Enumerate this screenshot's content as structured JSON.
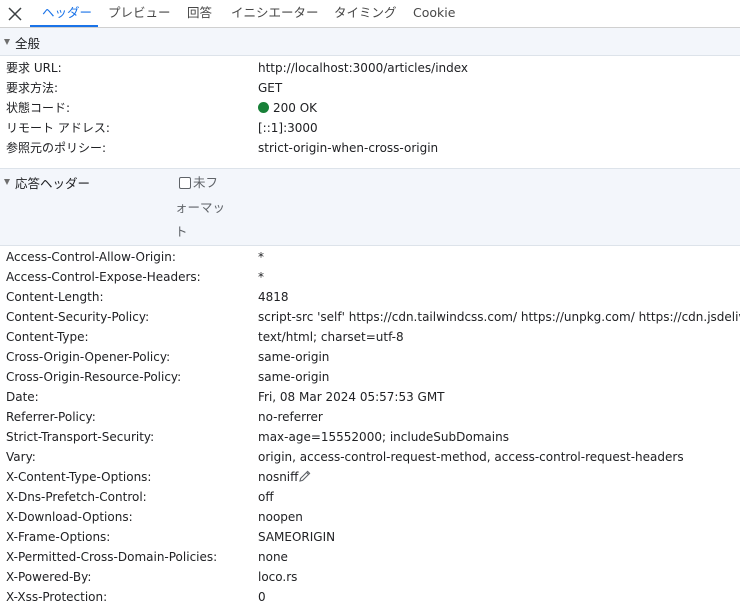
{
  "tabs": [
    {
      "label": "ヘッダー",
      "active": true
    },
    {
      "label": "プレビュー"
    },
    {
      "label": "回答"
    },
    {
      "label": "イニシエーター"
    },
    {
      "label": "タイミング"
    },
    {
      "label": "Cookie"
    }
  ],
  "general": {
    "title": "全般",
    "rows": [
      {
        "key": "要求 URL:",
        "value": "http://localhost:3000/articles/index"
      },
      {
        "key": "要求方法:",
        "value": "GET"
      },
      {
        "key": "状態コード:",
        "value": "200 OK"
      },
      {
        "key": "リモート アドレス:",
        "value": "[::1]:3000"
      },
      {
        "key": "参照元のポリシー:",
        "value": "strict-origin-when-cross-origin"
      }
    ]
  },
  "response": {
    "title": "応答ヘッダー",
    "raw_label": "未フォーマット",
    "rows": [
      {
        "key": "Access-Control-Allow-Origin:",
        "value": "*"
      },
      {
        "key": "Access-Control-Expose-Headers:",
        "value": "*"
      },
      {
        "key": "Content-Length:",
        "value": "4818"
      },
      {
        "key": "Content-Security-Policy:",
        "value": "script-src 'self' https://cdn.tailwindcss.com/ https://unpkg.com/ https://cdn.jsdelivr.net/"
      },
      {
        "key": "Content-Type:",
        "value": "text/html; charset=utf-8"
      },
      {
        "key": "Cross-Origin-Opener-Policy:",
        "value": "same-origin"
      },
      {
        "key": "Cross-Origin-Resource-Policy:",
        "value": "same-origin"
      },
      {
        "key": "Date:",
        "value": "Fri, 08 Mar 2024 05:57:53 GMT"
      },
      {
        "key": "Referrer-Policy:",
        "value": "no-referrer"
      },
      {
        "key": "Strict-Transport-Security:",
        "value": "max-age=15552000; includeSubDomains"
      },
      {
        "key": "Vary:",
        "value": "origin, access-control-request-method, access-control-request-headers"
      },
      {
        "key": "X-Content-Type-Options:",
        "value": "nosniff"
      },
      {
        "key": "X-Dns-Prefetch-Control:",
        "value": "off"
      },
      {
        "key": "X-Download-Options:",
        "value": "noopen"
      },
      {
        "key": "X-Frame-Options:",
        "value": "SAMEORIGIN"
      },
      {
        "key": "X-Permitted-Cross-Domain-Policies:",
        "value": "none"
      },
      {
        "key": "X-Powered-By:",
        "value": "loco.rs"
      },
      {
        "key": "X-Xss-Protection:",
        "value": "0"
      }
    ]
  },
  "colors": {
    "accent": "#1a73e8",
    "status_ok": "#188038"
  },
  "icons": {
    "close": "close-icon",
    "edit": "pencil-icon",
    "status": "status-dot-icon"
  }
}
